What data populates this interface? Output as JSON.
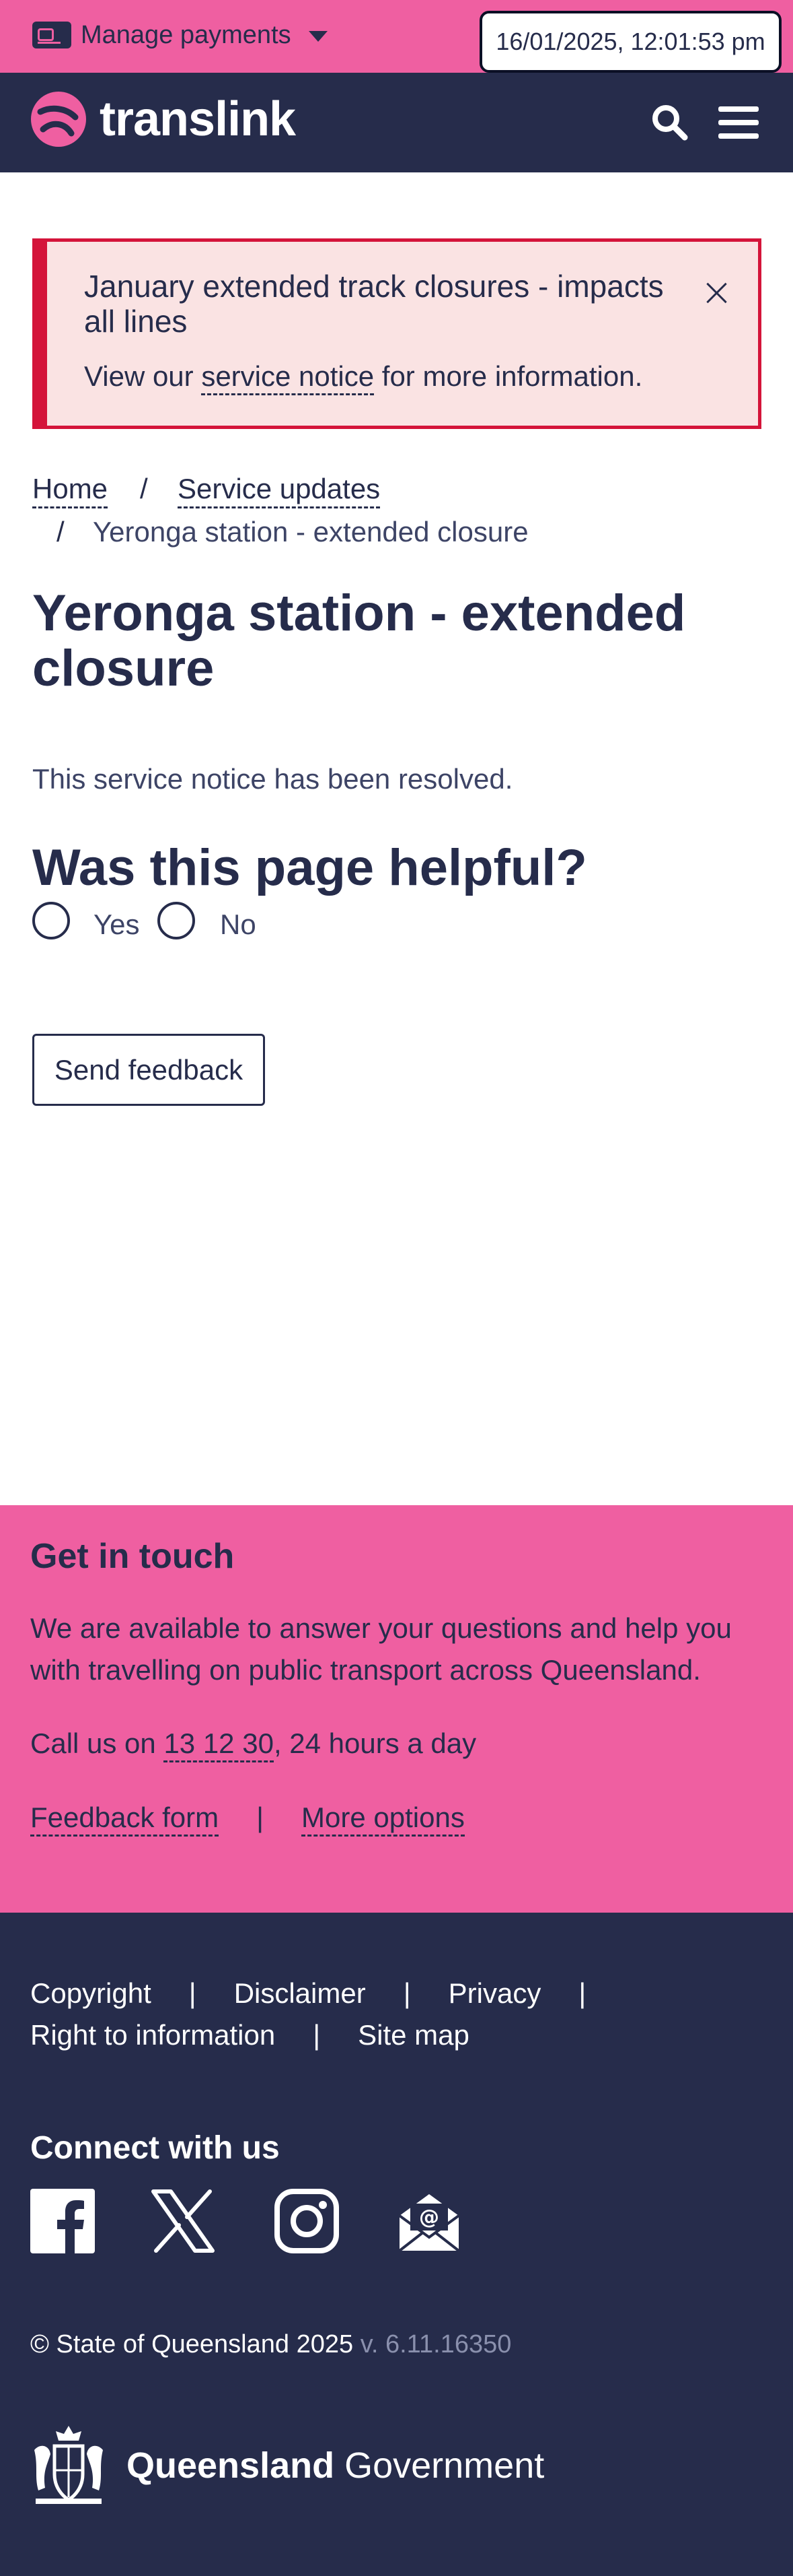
{
  "topbar": {
    "manage_payments": "Manage payments",
    "datetime": "16/01/2025, 12:01:53 pm"
  },
  "header": {
    "logo": "translink"
  },
  "alert": {
    "title": "January extended track closures - impacts all lines",
    "body_prefix": "View our ",
    "body_link": "service notice",
    "body_suffix": " for more information."
  },
  "breadcrumb": {
    "home": "Home",
    "sep": "/",
    "service_updates": "Service updates",
    "current": "Yeronga station - extended closure"
  },
  "page": {
    "title": "Yeronga station - extended closure",
    "resolved": "This service notice has been resolved."
  },
  "feedback": {
    "question": "Was this page helpful?",
    "yes": "Yes",
    "no": "No",
    "send": "Send feedback"
  },
  "contact": {
    "title": "Get in touch",
    "text": "We are available to answer your questions and help you with travelling on public transport across Queensland.",
    "call_prefix": "Call us on ",
    "phone": "13 12 30",
    "call_suffix": ", 24 hours a day",
    "feedback_form": "Feedback form",
    "sep": "|",
    "more_options": "More options"
  },
  "footer": {
    "copyright_link": "Copyright",
    "disclaimer": "Disclaimer",
    "privacy": "Privacy",
    "right_to_info": "Right to information",
    "site_map": "Site map",
    "sep": "|",
    "connect_title": "Connect with us",
    "copyright": "© State of Queensland 2025",
    "version": "v. 6.11.16350",
    "gov_bold": "Queensland",
    "gov_regular": "Government"
  },
  "colors": {
    "pink": "#ef5fa1",
    "navy": "#262c4b",
    "alert_red": "#d4143a",
    "alert_bg": "#fae3e3"
  }
}
